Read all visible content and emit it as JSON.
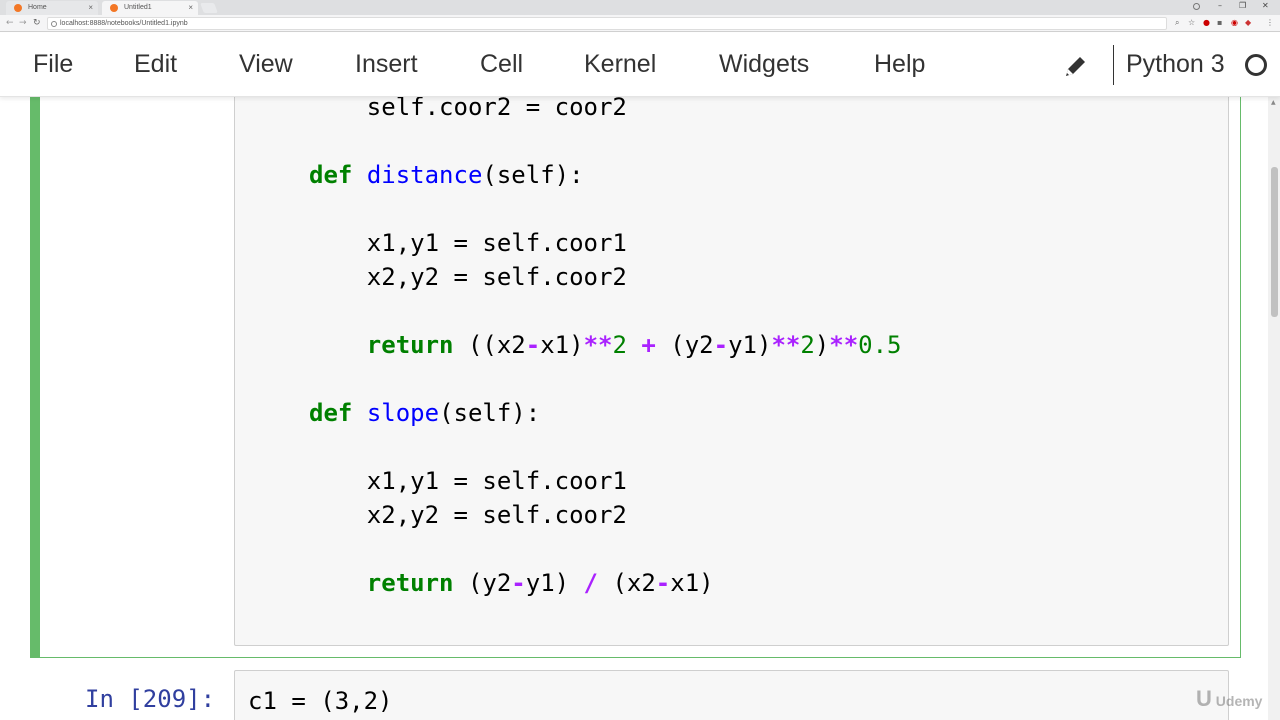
{
  "browser": {
    "tabs": [
      {
        "label": "Home",
        "active": false
      },
      {
        "label": "Untitled1",
        "active": true
      }
    ],
    "url": "localhost:8888/notebooks/Untitled1.ipynb",
    "window_controls": {
      "minimize": "–",
      "maximize": "❐",
      "close": "✕"
    }
  },
  "menubar": {
    "items": [
      "File",
      "Edit",
      "View",
      "Insert",
      "Cell",
      "Kernel",
      "Widgets",
      "Help"
    ],
    "kernel_name": "Python 3",
    "edit_mode_icon": "pencil-icon",
    "kernel_status_icon": "kernel-idle-circle-icon"
  },
  "cell_selected": {
    "border_color": "#66bb6a",
    "lines": [
      [
        {
          "t": "    self.coor2 = coor2",
          "c": "plain"
        }
      ],
      [],
      [
        {
          "t": "def",
          "c": "kw"
        },
        {
          "t": " ",
          "c": "plain"
        },
        {
          "t": "distance",
          "c": "fn"
        },
        {
          "t": "(self):",
          "c": "plain"
        }
      ],
      [],
      [
        {
          "t": "    x1,y1 = self.coor1",
          "c": "plain"
        }
      ],
      [
        {
          "t": "    x2,y2 = self.coor2",
          "c": "plain"
        }
      ],
      [],
      [
        {
          "t": "    ",
          "c": "plain"
        },
        {
          "t": "return",
          "c": "kw"
        },
        {
          "t": " ((x2",
          "c": "plain"
        },
        {
          "t": "-",
          "c": "op"
        },
        {
          "t": "x1)",
          "c": "plain"
        },
        {
          "t": "**",
          "c": "op"
        },
        {
          "t": "2",
          "c": "num"
        },
        {
          "t": " ",
          "c": "plain"
        },
        {
          "t": "+",
          "c": "op"
        },
        {
          "t": " (y2",
          "c": "plain"
        },
        {
          "t": "-",
          "c": "op"
        },
        {
          "t": "y1)",
          "c": "plain"
        },
        {
          "t": "**",
          "c": "op"
        },
        {
          "t": "2",
          "c": "num"
        },
        {
          "t": ")",
          "c": "plain"
        },
        {
          "t": "**",
          "c": "op"
        },
        {
          "t": "0.5",
          "c": "num"
        }
      ],
      [],
      [
        {
          "t": "def",
          "c": "kw"
        },
        {
          "t": " ",
          "c": "plain"
        },
        {
          "t": "slope",
          "c": "fn"
        },
        {
          "t": "(self):",
          "c": "plain"
        }
      ],
      [],
      [
        {
          "t": "    x1,y1 = self.coor1",
          "c": "plain"
        }
      ],
      [
        {
          "t": "    x2,y2 = self.coor2",
          "c": "plain"
        }
      ],
      [],
      [
        {
          "t": "    ",
          "c": "plain"
        },
        {
          "t": "return",
          "c": "kw"
        },
        {
          "t": " (y2",
          "c": "plain"
        },
        {
          "t": "-",
          "c": "op"
        },
        {
          "t": "y1) ",
          "c": "plain"
        },
        {
          "t": "/",
          "c": "op"
        },
        {
          "t": " (x2",
          "c": "plain"
        },
        {
          "t": "-",
          "c": "op"
        },
        {
          "t": "x1)",
          "c": "plain"
        }
      ]
    ]
  },
  "cell_next": {
    "prompt": "In [209]:",
    "code": "c1 = (3,2)"
  },
  "watermark": {
    "mark": "U",
    "text": "Udemy"
  }
}
